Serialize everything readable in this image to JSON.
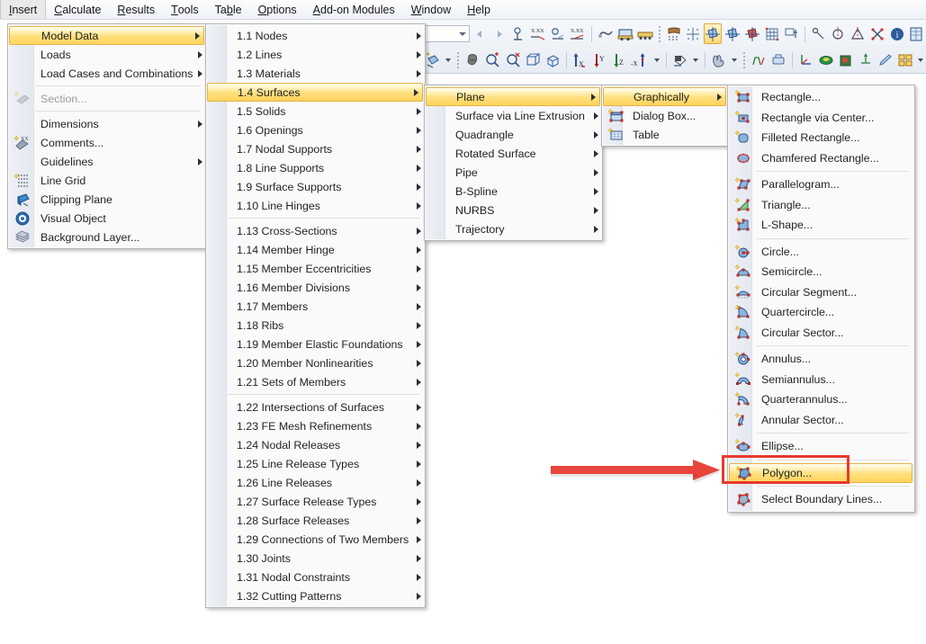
{
  "app": {
    "accent_yellow": "#ffd45e",
    "annotation_red": "#e8392e",
    "menu_bg": "#fafafa"
  },
  "menubar": {
    "items": [
      {
        "label": "Insert",
        "mnemonic": "I",
        "active": true
      },
      {
        "label": "Calculate",
        "mnemonic": "C",
        "active": false
      },
      {
        "label": "Results",
        "mnemonic": "R",
        "active": false
      },
      {
        "label": "Tools",
        "mnemonic": "T",
        "active": false
      },
      {
        "label": "Table",
        "mnemonic": "b",
        "active": false
      },
      {
        "label": "Options",
        "mnemonic": "O",
        "active": false
      },
      {
        "label": "Add-on Modules",
        "mnemonic": "A",
        "active": false
      },
      {
        "label": "Window",
        "mnemonic": "W",
        "active": false
      },
      {
        "label": "Help",
        "mnemonic": "H",
        "active": false
      }
    ]
  },
  "toolbar": {
    "combo_value": "",
    "row1_icons": [
      "nav-back-icon",
      "nav-forward-icon",
      "dimension-icon",
      "dimension-xx-icon",
      "annotation-icon",
      "annotation-xx-icon",
      "separator",
      "pointer-icon",
      "support-icon",
      "support-multi-icon",
      "dotgrid-icon",
      "snap-grid-icon",
      "object-snap-icon",
      "render-surfaces-icon",
      "render-solids-icon",
      "render-wire-icon",
      "mesh-icon",
      "loads-icon",
      "line-snap-icon",
      "mirror-axis-icon",
      "mirror-icon",
      "intersect-icon",
      "info-icon",
      "table-icon"
    ],
    "row2_icons": [
      "new-object-icon",
      "dropdown-caret",
      "select-special-icon",
      "zoom-in-icon",
      "zoom-out-icon",
      "view-3d-icon",
      "view-iso-icon",
      "view-x-icon",
      "view-y-icon",
      "view-z-icon",
      "view-negx-icon",
      "dropdown-caret",
      "render-mode-icon",
      "dropdown-caret",
      "hand-icon",
      "dropdown-caret",
      "bend-icon",
      "printer-icon",
      "axis-icon",
      "surface-result-icon",
      "solid-result-icon",
      "deform-icon",
      "edit-icon",
      "window-tile-icon",
      "dropdown-caret"
    ]
  },
  "menus": {
    "insert": {
      "name": "Insert",
      "items": [
        {
          "label": "Model Data",
          "icon": "",
          "submenu": true,
          "highlight": true,
          "disabled": false
        },
        {
          "label": "Loads",
          "icon": "",
          "submenu": true,
          "highlight": false,
          "disabled": false
        },
        {
          "label": "Load Cases and Combinations",
          "icon": "",
          "submenu": true,
          "highlight": false,
          "disabled": false
        },
        {
          "separator": true
        },
        {
          "label": "Section...",
          "icon": "section-icon",
          "submenu": false,
          "highlight": false,
          "disabled": true
        },
        {
          "separator": true
        },
        {
          "label": "Dimensions",
          "icon": "",
          "submenu": true,
          "highlight": false,
          "disabled": false
        },
        {
          "label": "Comments...",
          "icon": "comment-icon",
          "submenu": false,
          "highlight": false,
          "disabled": false
        },
        {
          "label": "Guidelines",
          "icon": "",
          "submenu": true,
          "highlight": false,
          "disabled": false
        },
        {
          "label": "Line Grid",
          "icon": "line-grid-icon",
          "submenu": false,
          "highlight": false,
          "disabled": false
        },
        {
          "label": "Clipping Plane",
          "icon": "clipping-plane-icon",
          "submenu": false,
          "highlight": false,
          "disabled": false
        },
        {
          "label": "Visual Object",
          "icon": "visual-object-icon",
          "submenu": false,
          "highlight": false,
          "disabled": false
        },
        {
          "label": "Background Layer...",
          "icon": "background-layer-icon",
          "submenu": false,
          "highlight": false,
          "disabled": false
        }
      ]
    },
    "model_data": {
      "name": "Model Data",
      "items": [
        {
          "label": "1.1 Nodes",
          "submenu": true,
          "highlight": false
        },
        {
          "label": "1.2 Lines",
          "submenu": true,
          "highlight": false
        },
        {
          "label": "1.3 Materials",
          "submenu": true,
          "highlight": false
        },
        {
          "label": "1.4 Surfaces",
          "submenu": true,
          "highlight": true
        },
        {
          "label": "1.5 Solids",
          "submenu": true,
          "highlight": false
        },
        {
          "label": "1.6 Openings",
          "submenu": true,
          "highlight": false
        },
        {
          "label": "1.7 Nodal Supports",
          "submenu": true,
          "highlight": false
        },
        {
          "label": "1.8 Line Supports",
          "submenu": true,
          "highlight": false
        },
        {
          "label": "1.9 Surface Supports",
          "submenu": true,
          "highlight": false
        },
        {
          "label": "1.10 Line Hinges",
          "submenu": true,
          "highlight": false
        },
        {
          "separator": true
        },
        {
          "label": "1.13 Cross-Sections",
          "submenu": true,
          "highlight": false
        },
        {
          "label": "1.14 Member Hinge",
          "submenu": true,
          "highlight": false
        },
        {
          "label": "1.15 Member Eccentricities",
          "submenu": true,
          "highlight": false
        },
        {
          "label": "1.16 Member Divisions",
          "submenu": true,
          "highlight": false
        },
        {
          "label": "1.17 Members",
          "submenu": true,
          "highlight": false
        },
        {
          "label": "1.18 Ribs",
          "submenu": true,
          "highlight": false
        },
        {
          "label": "1.19 Member Elastic Foundations",
          "submenu": true,
          "highlight": false
        },
        {
          "label": "1.20 Member Nonlinearities",
          "submenu": true,
          "highlight": false
        },
        {
          "label": "1.21 Sets of Members",
          "submenu": true,
          "highlight": false
        },
        {
          "separator": true
        },
        {
          "label": "1.22 Intersections of Surfaces",
          "submenu": true,
          "highlight": false
        },
        {
          "label": "1.23 FE Mesh Refinements",
          "submenu": true,
          "highlight": false
        },
        {
          "label": "1.24 Nodal Releases",
          "submenu": true,
          "highlight": false
        },
        {
          "label": "1.25 Line Release Types",
          "submenu": true,
          "highlight": false
        },
        {
          "label": "1.26 Line Releases",
          "submenu": true,
          "highlight": false
        },
        {
          "label": "1.27 Surface Release Types",
          "submenu": true,
          "highlight": false
        },
        {
          "label": "1.28 Surface Releases",
          "submenu": true,
          "highlight": false
        },
        {
          "label": "1.29 Connections of Two Members",
          "submenu": true,
          "highlight": false
        },
        {
          "label": "1.30 Joints",
          "submenu": true,
          "highlight": false
        },
        {
          "label": "1.31 Nodal Constraints",
          "submenu": true,
          "highlight": false
        },
        {
          "label": "1.32 Cutting Patterns",
          "submenu": true,
          "highlight": false
        }
      ]
    },
    "surfaces": {
      "name": "1.4 Surfaces",
      "items": [
        {
          "label": "Plane",
          "submenu": true,
          "highlight": true
        },
        {
          "label": "Surface via Line Extrusion",
          "submenu": true,
          "highlight": false
        },
        {
          "label": "Quadrangle",
          "submenu": true,
          "highlight": false
        },
        {
          "label": "Rotated Surface",
          "submenu": true,
          "highlight": false
        },
        {
          "label": "Pipe",
          "submenu": true,
          "highlight": false
        },
        {
          "label": "B-Spline",
          "submenu": true,
          "highlight": false
        },
        {
          "label": "NURBS",
          "submenu": true,
          "highlight": false
        },
        {
          "label": "Trajectory",
          "submenu": true,
          "highlight": false
        }
      ]
    },
    "plane": {
      "name": "Plane",
      "items": [
        {
          "label": "Graphically",
          "icon": "",
          "submenu": true,
          "highlight": true
        },
        {
          "label": "Dialog Box...",
          "icon": "dialog-box-icon",
          "submenu": false,
          "highlight": false
        },
        {
          "label": "Table",
          "icon": "table-icon",
          "submenu": false,
          "highlight": false
        }
      ]
    },
    "shapes": {
      "name": "Graphically",
      "items": [
        {
          "label": "Rectangle...",
          "icon": "rectangle-icon",
          "highlight": false
        },
        {
          "label": "Rectangle via Center...",
          "icon": "rectangle-center-icon",
          "highlight": false
        },
        {
          "label": "Filleted Rectangle...",
          "icon": "filleted-rectangle-icon",
          "highlight": false
        },
        {
          "label": "Chamfered Rectangle...",
          "icon": "chamfered-rectangle-icon",
          "highlight": false
        },
        {
          "separator": true
        },
        {
          "label": "Parallelogram...",
          "icon": "parallelogram-icon",
          "highlight": false
        },
        {
          "label": "Triangle...",
          "icon": "triangle-icon",
          "highlight": false
        },
        {
          "label": "L-Shape...",
          "icon": "l-shape-icon",
          "highlight": false
        },
        {
          "separator": true
        },
        {
          "label": "Circle...",
          "icon": "circle-icon",
          "highlight": false
        },
        {
          "label": "Semicircle...",
          "icon": "semicircle-icon",
          "highlight": false
        },
        {
          "label": "Circular Segment...",
          "icon": "circular-segment-icon",
          "highlight": false
        },
        {
          "label": "Quartercircle...",
          "icon": "quartercircle-icon",
          "highlight": false
        },
        {
          "label": "Circular Sector...",
          "icon": "circular-sector-icon",
          "highlight": false
        },
        {
          "separator": true
        },
        {
          "label": "Annulus...",
          "icon": "annulus-icon",
          "highlight": false
        },
        {
          "label": "Semiannulus...",
          "icon": "semiannulus-icon",
          "highlight": false
        },
        {
          "label": "Quarterannulus...",
          "icon": "quarterannulus-icon",
          "highlight": false
        },
        {
          "label": "Annular Sector...",
          "icon": "annular-sector-icon",
          "highlight": false
        },
        {
          "separator": true
        },
        {
          "label": "Ellipse...",
          "icon": "ellipse-icon",
          "highlight": false
        },
        {
          "separator": true
        },
        {
          "label": "Polygon...",
          "icon": "polygon-icon",
          "highlight": true
        },
        {
          "separator": true
        },
        {
          "label": "Select Boundary Lines...",
          "icon": "select-boundary-lines-icon",
          "highlight": false
        }
      ]
    }
  },
  "annotation": {
    "arrow": "red-arrow-pointer",
    "box": "red-highlight-box",
    "target": "Polygon..."
  }
}
